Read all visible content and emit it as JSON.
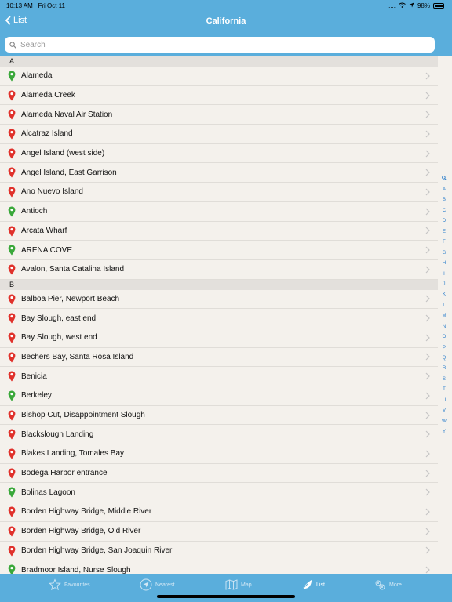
{
  "status_bar": {
    "time": "10:13 AM",
    "date": "Fri Oct 11",
    "battery": "98%"
  },
  "nav": {
    "back_label": "List",
    "title": "California"
  },
  "search": {
    "placeholder": "Search"
  },
  "sections": [
    {
      "letter": "A",
      "items": [
        {
          "name": "Alameda",
          "pin": "green"
        },
        {
          "name": "Alameda Creek",
          "pin": "red"
        },
        {
          "name": "Alameda Naval Air Station",
          "pin": "red"
        },
        {
          "name": "Alcatraz Island",
          "pin": "red"
        },
        {
          "name": "Angel Island (west side)",
          "pin": "red"
        },
        {
          "name": "Angel Island, East Garrison",
          "pin": "red"
        },
        {
          "name": "Ano Nuevo Island",
          "pin": "red"
        },
        {
          "name": "Antioch",
          "pin": "green"
        },
        {
          "name": "Arcata Wharf",
          "pin": "red"
        },
        {
          "name": "ARENA COVE",
          "pin": "green"
        },
        {
          "name": "Avalon, Santa Catalina Island",
          "pin": "red"
        }
      ]
    },
    {
      "letter": "B",
      "items": [
        {
          "name": "Balboa Pier, Newport Beach",
          "pin": "red"
        },
        {
          "name": "Bay Slough, east end",
          "pin": "red"
        },
        {
          "name": "Bay Slough, west end",
          "pin": "red"
        },
        {
          "name": "Bechers Bay, Santa Rosa Island",
          "pin": "red"
        },
        {
          "name": "Benicia",
          "pin": "red"
        },
        {
          "name": "Berkeley",
          "pin": "green"
        },
        {
          "name": "Bishop Cut, Disappointment Slough",
          "pin": "red"
        },
        {
          "name": "Blackslough Landing",
          "pin": "red"
        },
        {
          "name": "Blakes Landing, Tomales Bay",
          "pin": "red"
        },
        {
          "name": "Bodega Harbor entrance",
          "pin": "red"
        },
        {
          "name": "Bolinas Lagoon",
          "pin": "green"
        },
        {
          "name": "Borden Highway Bridge, Middle River",
          "pin": "red"
        },
        {
          "name": "Borden Highway Bridge, Old River",
          "pin": "red"
        },
        {
          "name": "Borden Highway Bridge, San Joaquin River",
          "pin": "red"
        },
        {
          "name": "Bradmoor Island, Nurse Slough",
          "pin": "green"
        }
      ]
    }
  ],
  "index_letters": [
    "A",
    "B",
    "C",
    "D",
    "E",
    "F",
    "G",
    "H",
    "I",
    "J",
    "K",
    "L",
    "M",
    "N",
    "O",
    "P",
    "Q",
    "R",
    "S",
    "T",
    "U",
    "V",
    "W",
    "Y"
  ],
  "tabs": [
    {
      "label": "Favourites",
      "icon": "star-icon",
      "active": false
    },
    {
      "label": "Nearest",
      "icon": "location-arrow-icon",
      "active": false
    },
    {
      "label": "Map",
      "icon": "map-icon",
      "active": false
    },
    {
      "label": "List",
      "icon": "list-leaf-icon",
      "active": true
    },
    {
      "label": "More",
      "icon": "gears-icon",
      "active": false
    }
  ],
  "colors": {
    "bar": "#5aaedc",
    "pin_red": "#e0312b",
    "pin_green": "#3aa83a",
    "index": "#2a7ecb"
  }
}
